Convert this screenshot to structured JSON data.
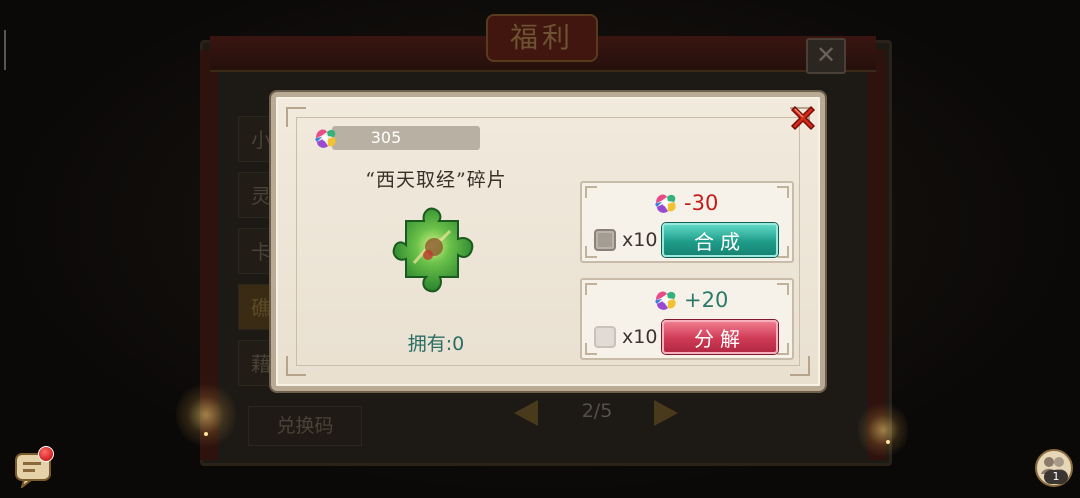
{
  "background": {
    "window_title": "福利",
    "tabs": [
      "小",
      "灵",
      "卡",
      "礁",
      "藉"
    ],
    "active_tab_index": 3,
    "pager": {
      "text": "2/5"
    },
    "redeem_label": "兑换码"
  },
  "dialog": {
    "currency": {
      "value": "305",
      "icon": "spirit-gem-icon"
    },
    "item_name": "“西天取经”碎片",
    "item_icon": "puzzle-piece-icon",
    "own_label": "拥有:0",
    "compose": {
      "cost": "-30",
      "multiplier": "x10",
      "checkbox_checked": false,
      "button_label": "合成"
    },
    "decompose": {
      "gain": "+20",
      "multiplier": "x10",
      "checkbox_checked": false,
      "button_label": "分解"
    }
  },
  "hud": {
    "chat_icon": "chat-bubble-icon",
    "friends_icon": "friends-icon",
    "friends_count": "1"
  },
  "colors": {
    "cost_negative": "#c21c1c",
    "gain_positive": "#2a7a6a",
    "compose_button": "#1f9d8a",
    "decompose_button": "#cf3b55"
  }
}
